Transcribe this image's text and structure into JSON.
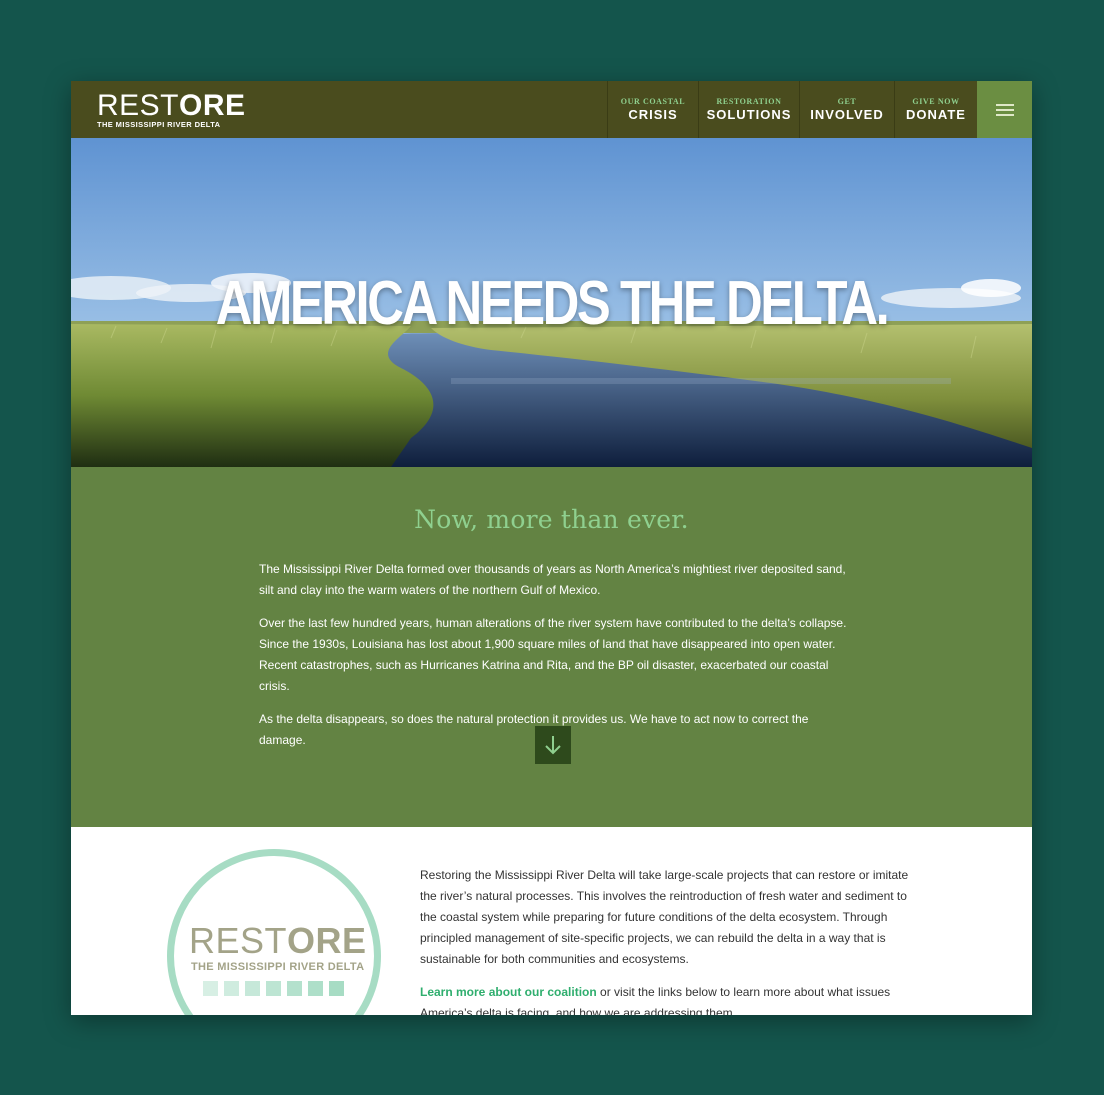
{
  "logo": {
    "word_light": "REST",
    "word_bold": "ORE",
    "tagline": "THE MISSISSIPPI RIVER DELTA"
  },
  "nav": [
    {
      "small": "OUR COASTAL",
      "big": "CRISIS"
    },
    {
      "small": "RESTORATION",
      "big": "SOLUTIONS"
    },
    {
      "small": "GET",
      "big": "INVOLVED"
    },
    {
      "small": "GIVE NOW",
      "big": "DONATE"
    }
  ],
  "menu_icon": "hamburger-icon",
  "hero": {
    "title": "AMERICA NEEDS THE DELTA."
  },
  "intro": {
    "heading": "Now, more than ever.",
    "paragraphs": [
      "The Mississippi River Delta formed over thousands of years as North America’s mightiest river deposited sand, silt and clay into the warm waters of the northern Gulf of Mexico.",
      "Over the last few hundred years, human alterations of the river system have contributed to the delta’s collapse. Since the 1930s, Louisiana has lost about 1,900 square miles of land that have disappeared into open water. Recent catastrophes, such as Hurricanes Katrina and Rita, and the BP oil disaster, exacerbated our coastal crisis.",
      "As the delta disappears, so does the natural protection it provides us. We have to act now to correct the damage."
    ],
    "scroll_icon": "arrow-down-icon"
  },
  "about": {
    "badge": {
      "word_light": "REST",
      "word_bold": "ORE",
      "tagline": "THE MISSISSIPPI RIVER DELTA"
    },
    "paragraph": "Restoring the Mississippi River Delta will take large-scale projects that can restore or imitate the river’s natural processes. This involves the reintroduction of fresh water and sediment to the coastal system while preparing for future conditions of the delta ecosystem. Through principled management of site-specific projects, we can rebuild the delta in a way that is sustainable for both communities and ecosystems.",
    "link_text": "Learn more about our coalition",
    "link_tail": " or visit the links below to learn more about what issues America’s delta is facing, and how we are addressing them."
  },
  "colors": {
    "page_bg": "#14554c",
    "header_bg": "#4a4c1e",
    "menu_bg": "#6b8e42",
    "section_green": "#638343",
    "accent_green": "#8fd08f",
    "badge_mint": "#a7dcc4",
    "link_green": "#2fae6e"
  }
}
